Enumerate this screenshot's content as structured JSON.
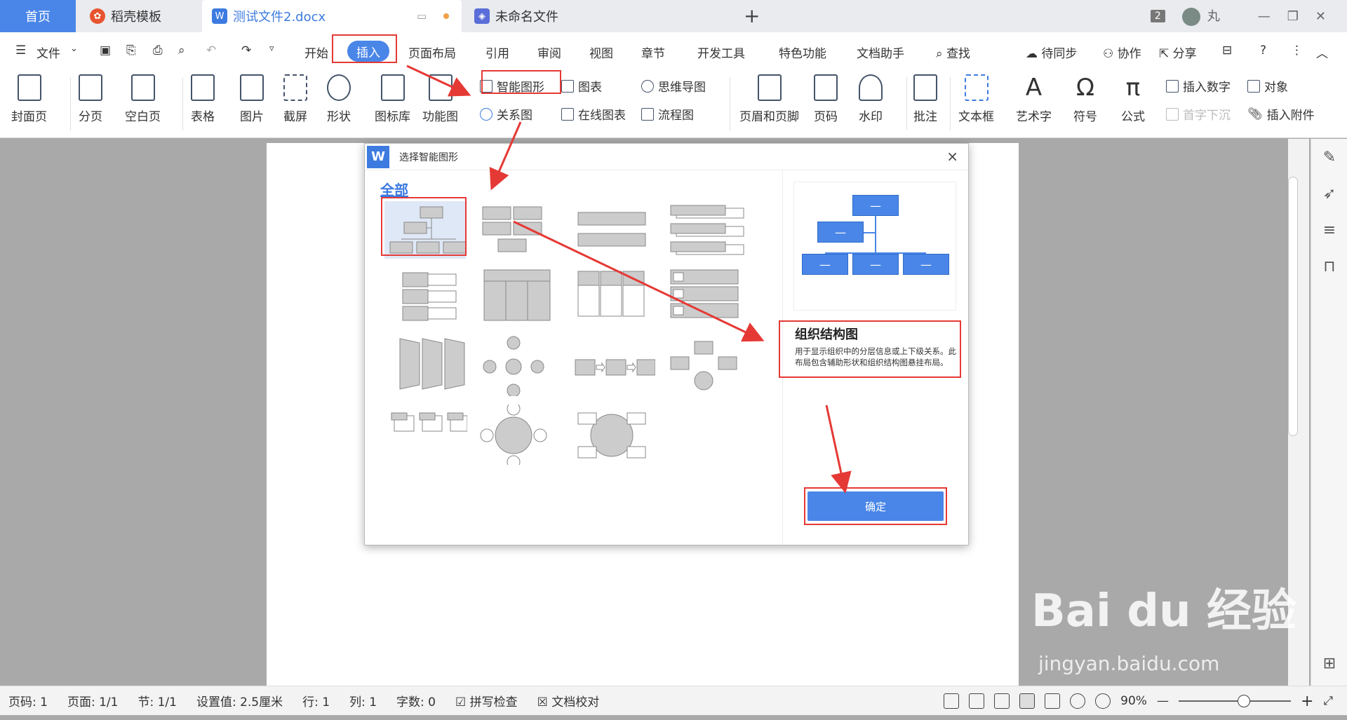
{
  "tabs": {
    "home": "首页",
    "template": "稻壳模板",
    "doc": "测试文件2.docx",
    "unnamed": "未命名文件",
    "add": "+"
  },
  "window": {
    "count_badge": "2",
    "user": "丸"
  },
  "menu": {
    "file": "文件",
    "items": [
      "开始",
      "插入",
      "页面布局",
      "引用",
      "审阅",
      "视图",
      "章节",
      "开发工具",
      "特色功能",
      "文档助手"
    ],
    "search": "查找",
    "sync": "待同步",
    "collab": "协作",
    "share": "分享"
  },
  "ribbon": {
    "cover": "封面页",
    "pagebreak": "分页",
    "blank": "空白页",
    "table": "表格",
    "picture": "图片",
    "screenshot": "截屏",
    "shape": "形状",
    "iconlib": "图标库",
    "funcchart": "功能图",
    "smartart": "智能图形",
    "chart": "图表",
    "mindmap": "思维导图",
    "relation": "关系图",
    "onlinechart": "在线图表",
    "flowchart": "流程图",
    "headerfooter": "页眉和页脚",
    "pagenum": "页码",
    "watermark": "水印",
    "comment": "批注",
    "textbox": "文本框",
    "wordart": "艺术字",
    "symbol": "符号",
    "formula": "公式",
    "insertnum": "插入数字",
    "object": "对象",
    "dropcap": "首字下沉",
    "attachment": "插入附件"
  },
  "dialog": {
    "logo": "W",
    "title": "选择智能图形",
    "category": "全部",
    "desc_title": "组织结构图",
    "desc_text": "用于显示组织中的分层信息或上下级关系。此布局包含辅助形状和组织结构图悬挂布局。",
    "ok": "确定",
    "close": "×"
  },
  "status": {
    "page_num": "页码: 1",
    "pages": "页面: 1/1",
    "section": "节: 1/1",
    "setting": "设置值: 2.5厘米",
    "row": "行: 1",
    "col": "列: 1",
    "words": "字数: 0",
    "spell": "拼写检查",
    "proof": "文档校对",
    "zoom": "90%"
  },
  "watermark": {
    "main": "Bai du 经验",
    "sub": "jingyan.baidu.com"
  },
  "colors": {
    "accent": "#4a86e8",
    "annotation_red": "#e53935"
  }
}
